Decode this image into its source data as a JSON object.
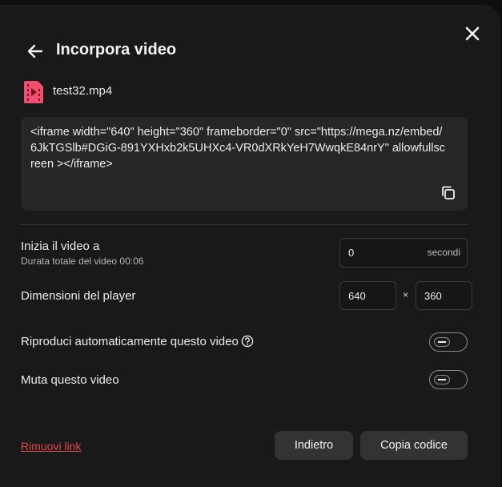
{
  "dialog": {
    "title": "Incorpora video",
    "file_name": "test32.mp4",
    "embed_code": "<iframe width=\"640\" height=\"360\" frameborder=\"0\" src=\"https://mega.nz/embed/6JkTGSlb#DGiG-891YXHxb2k5UHXc4-VR0dXRkYeH7WwqkE84nrY\" allowfullscreen ></iframe>"
  },
  "start": {
    "label": "Inizia il video a",
    "sublabel": "Durata totale del video 00:06",
    "value": "0",
    "unit": "secondi"
  },
  "size": {
    "label": "Dimensioni del player",
    "width": "640",
    "separator": "×",
    "height": "360"
  },
  "autoplay": {
    "label": "Riproduci automaticamente questo video",
    "enabled": false
  },
  "mute": {
    "label": "Muta questo video",
    "enabled": false
  },
  "footer": {
    "remove_link": "Rimuovi link",
    "back_button": "Indietro",
    "copy_button": "Copia codice"
  },
  "colors": {
    "background": "#191919",
    "accent_red": "#e0484f",
    "file_icon": "#f0506e"
  },
  "icons": {
    "close": "close-icon",
    "back": "arrow-left-icon",
    "file": "video-file-icon",
    "copy": "copy-icon",
    "help": "help-circle-icon"
  }
}
